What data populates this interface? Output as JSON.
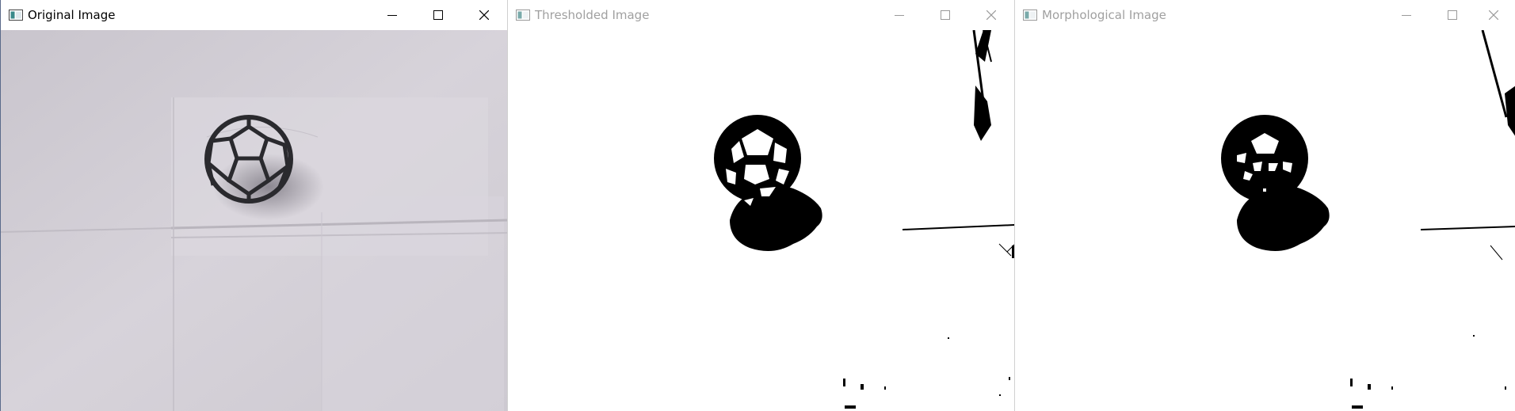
{
  "windows": [
    {
      "title": "Original Image",
      "active": true,
      "icon": "app-window-icon",
      "controls": [
        "minimize-icon",
        "maximize-icon",
        "close-icon"
      ]
    },
    {
      "title": "Thresholded Image",
      "active": false,
      "icon": "app-window-icon",
      "controls": [
        "minimize-icon",
        "maximize-icon",
        "close-icon"
      ]
    },
    {
      "title": "Morphological Image",
      "active": false,
      "icon": "app-window-icon",
      "controls": [
        "minimize-icon",
        "maximize-icon",
        "close-icon"
      ]
    }
  ],
  "colors": {
    "active_title": "#000000",
    "inactive_title": "#a0a0a0",
    "photo_background": "#cfcbd3",
    "mask_foreground": "#000000",
    "mask_background": "#ffffff"
  }
}
